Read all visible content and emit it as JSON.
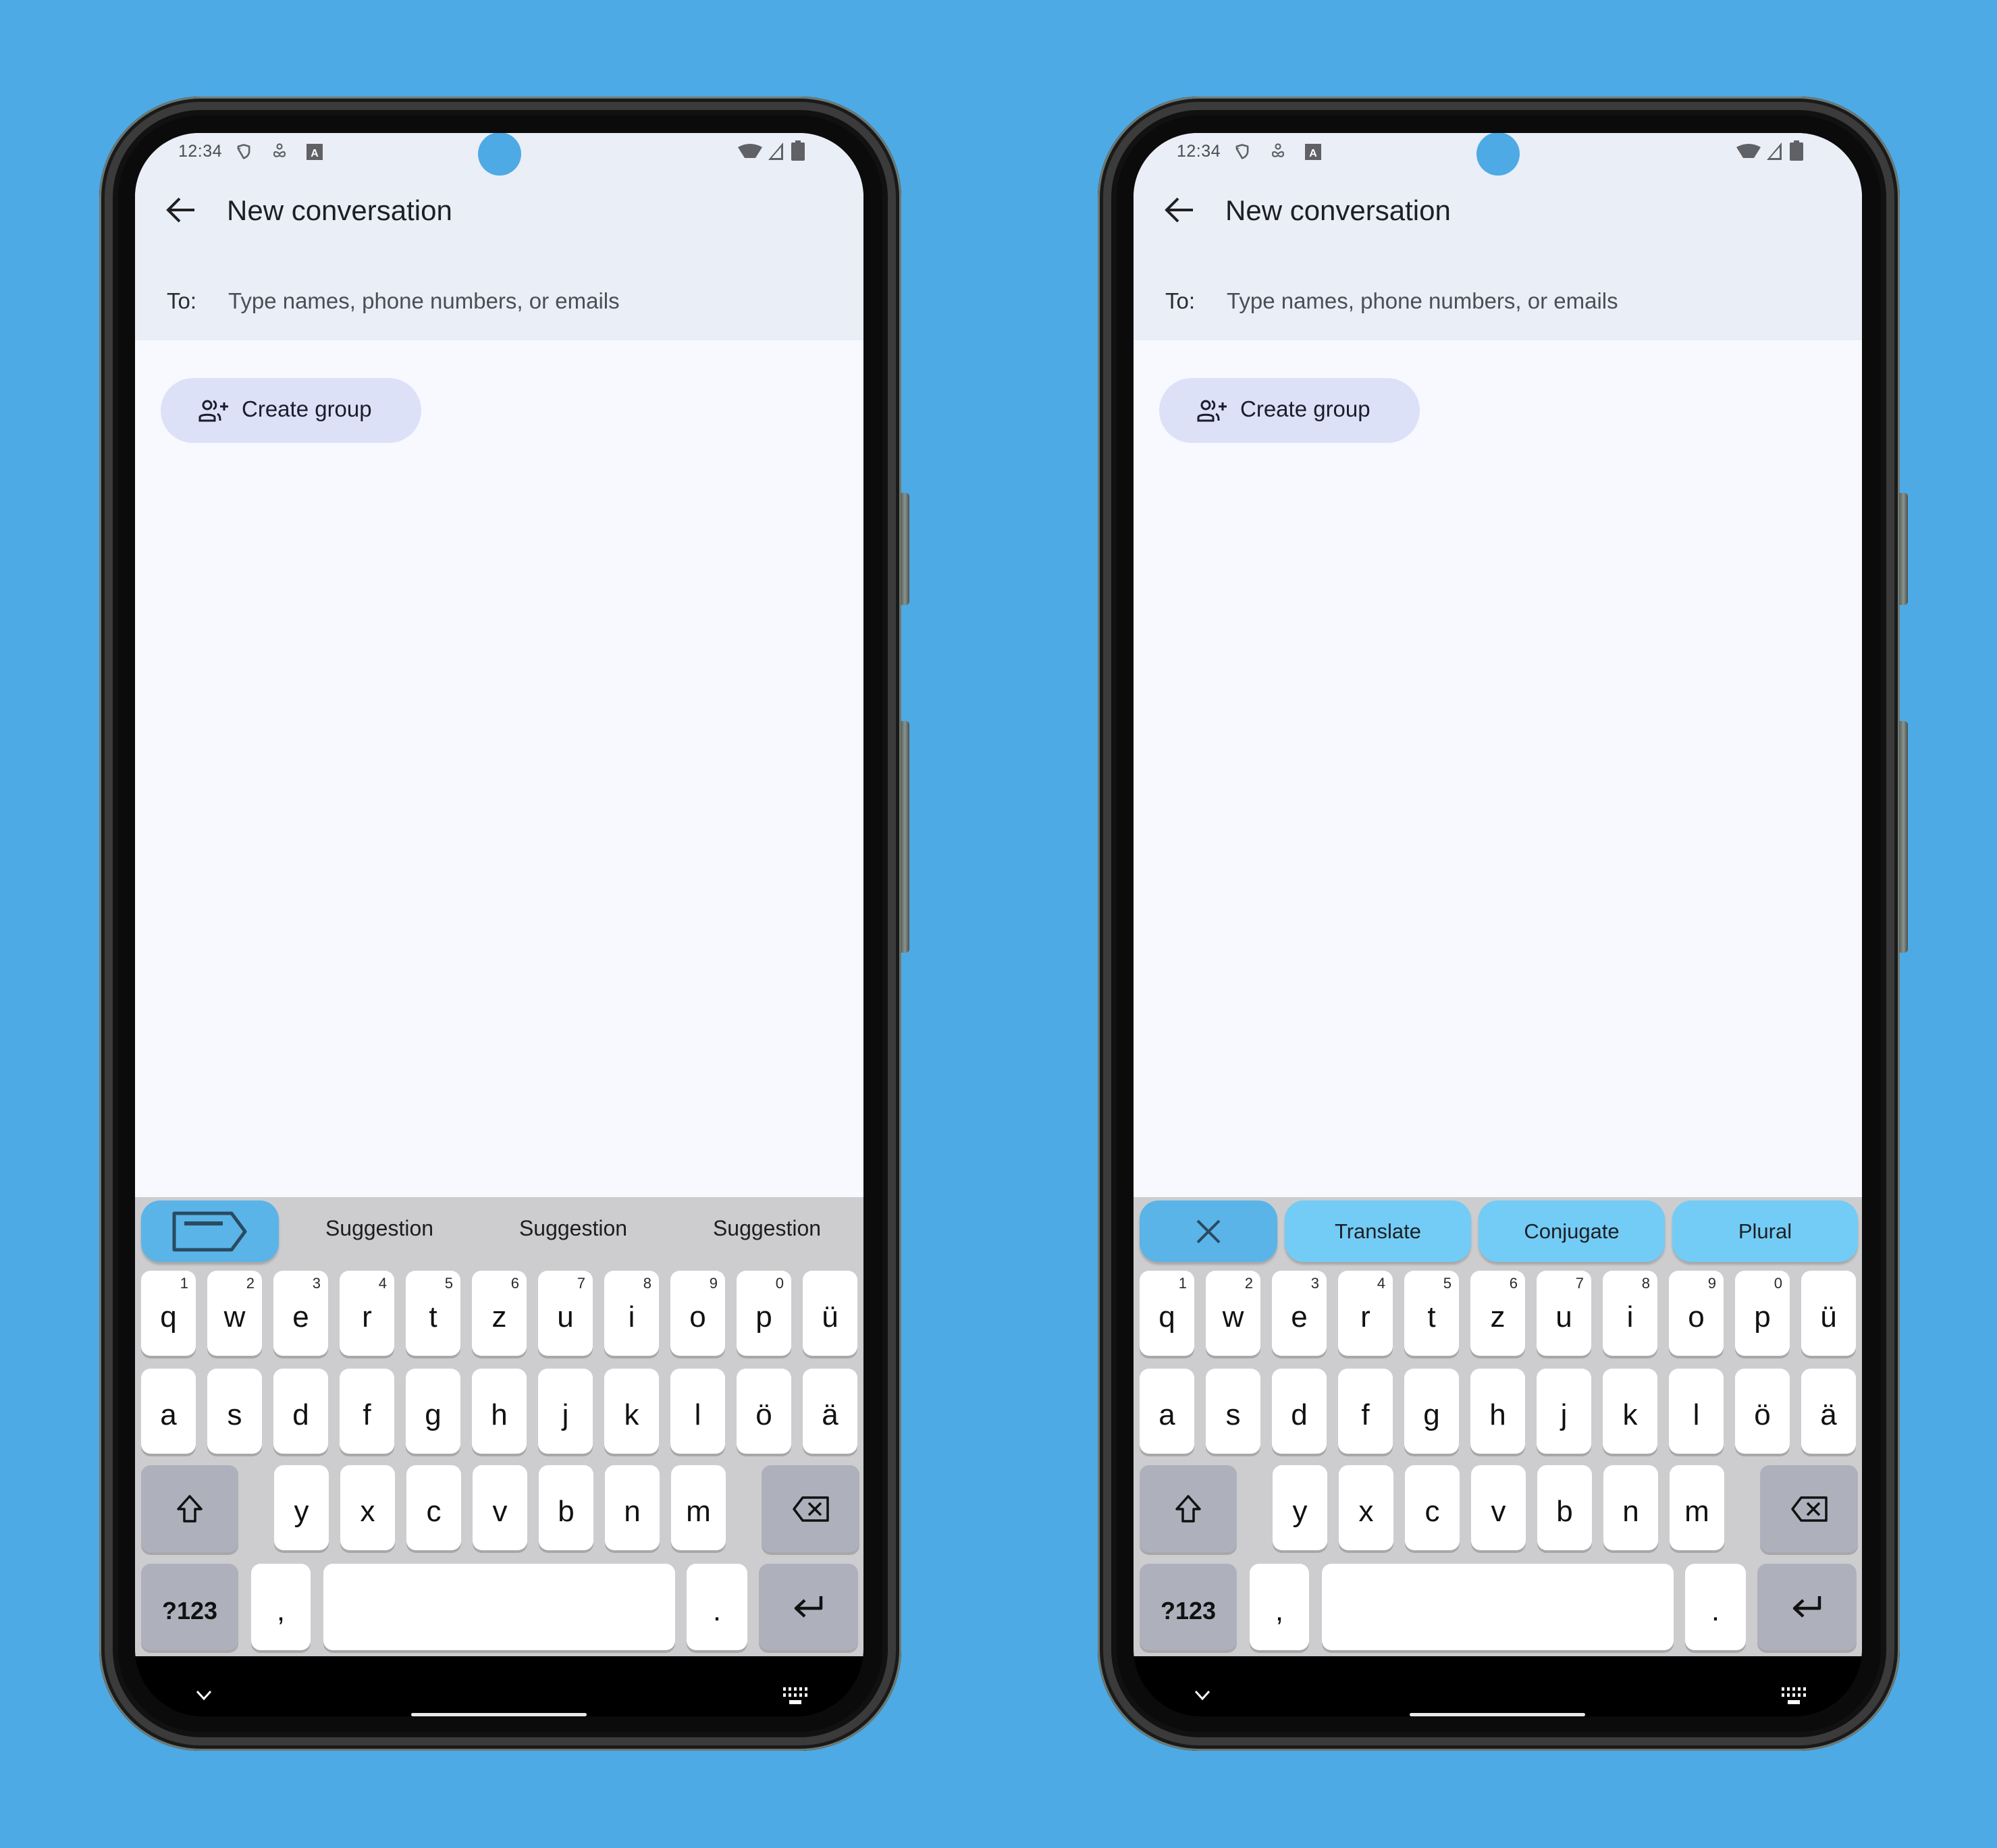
{
  "status_bar": {
    "time": "12:34",
    "left_icons": [
      "shield-icon",
      "accessibility-person-icon",
      "keyboard-a-icon"
    ],
    "right_icons": [
      "wifi-icon",
      "cellular-signal-icon",
      "battery-icon"
    ]
  },
  "app": {
    "title": "New conversation",
    "to_label": "To:",
    "to_placeholder": "Type names, phone numbers, or emails",
    "create_group_label": "Create group"
  },
  "keyboard": {
    "number_hints": [
      "1",
      "2",
      "3",
      "4",
      "5",
      "6",
      "7",
      "8",
      "9",
      "0",
      ""
    ],
    "row1": [
      "q",
      "w",
      "e",
      "r",
      "t",
      "z",
      "u",
      "i",
      "o",
      "p",
      "ü"
    ],
    "row2": [
      "a",
      "s",
      "d",
      "f",
      "g",
      "h",
      "j",
      "k",
      "l",
      "ö",
      "ä"
    ],
    "row3": [
      "y",
      "x",
      "c",
      "v",
      "b",
      "n",
      "m"
    ],
    "symbols_label": "?123",
    "comma": ",",
    "period": "."
  },
  "phones": [
    {
      "toolbar": {
        "toggle_icon": "tag-arrow-icon",
        "suggestions": [
          "Suggestion",
          "Suggestion",
          "Suggestion"
        ]
      }
    },
    {
      "toolbar": {
        "toggle_icon": "close-icon",
        "actions": [
          "Translate",
          "Conjugate",
          "Plural"
        ]
      }
    }
  ],
  "colors": {
    "background": "#4DAAE5",
    "toolbar_toggle": "#5AB4E8",
    "toolbar_action": "#73CCF5",
    "header": "#EAEEF6",
    "chip": "#DCE1F8"
  }
}
